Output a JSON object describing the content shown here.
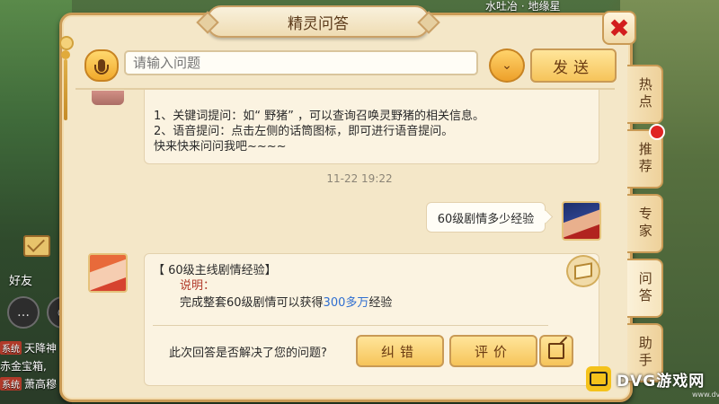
{
  "window": {
    "title": "精灵问答",
    "close_glyph": "✖"
  },
  "toolbar": {
    "input_placeholder": "请输入问题",
    "send_label": "发送",
    "dropdown_glyph": "⌄"
  },
  "chat": {
    "intro_lines": [
      "1、关键词提问：如“ 野猪” ，可以查询召唤灵野猪的相关信息。",
      "2、语音提问：点击左侧的话筒图标，即可进行语音提问。",
      "快来快来问问我吧~~~~"
    ],
    "timestamp": "11-22  19:22",
    "user_question": "60级剧情多少经验",
    "answer": {
      "title": "【 60级主线剧情经验】",
      "label": "说明：",
      "text_before": "完成整套60级剧情可以获得",
      "highlight": "300多万",
      "text_after": "经验"
    },
    "feedback_question": "此次回答是否解决了您的问题?",
    "btn_fix": "纠错",
    "btn_rate": "评价"
  },
  "tabs": [
    {
      "label": "热点"
    },
    {
      "label": "推荐",
      "badge": true
    },
    {
      "label": "专家"
    },
    {
      "label": "问答",
      "active": true
    },
    {
      "label": "助手"
    }
  ],
  "background": {
    "top_text": "水吐冶 · 地缘星",
    "friend_label": "好友",
    "chat_lines": [
      {
        "tag": "系统",
        "text": "天降神"
      },
      {
        "text": "赤金宝箱,"
      },
      {
        "tag": "系统",
        "text": "萧高穆"
      }
    ]
  },
  "watermark": {
    "brand": "DVG游戏网",
    "url": "www.dvg.cn"
  },
  "colors": {
    "panel_bg": "#f4e7c8",
    "border": "#c99a55",
    "button_gold": "#f6c45a",
    "close_red": "#d21d1d",
    "highlight_blue": "#2f6ed0",
    "label_red": "#b23a2a"
  }
}
